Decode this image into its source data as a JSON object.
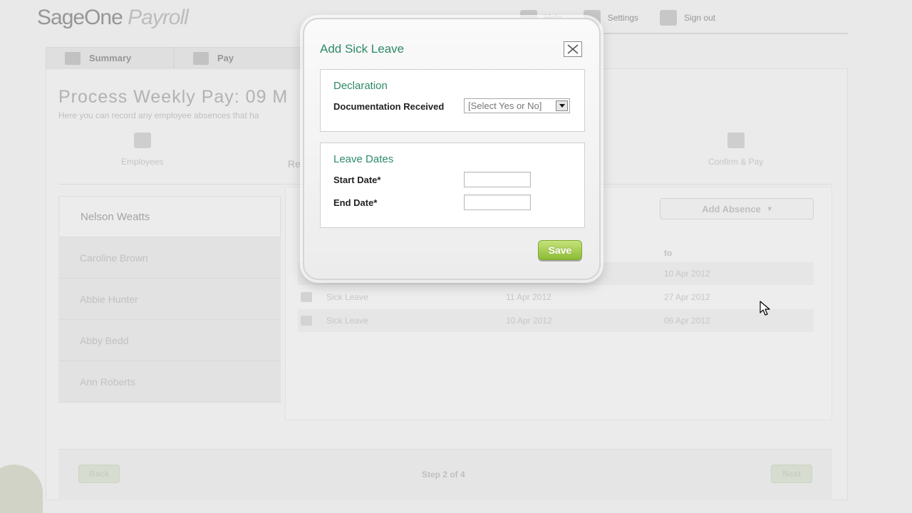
{
  "app": {
    "logo_main": "SageOne",
    "logo_product": "Payroll",
    "top_links": [
      "Help",
      "Settings",
      "Sign out"
    ]
  },
  "tabs": [
    {
      "label": "Summary",
      "icon": "summary-icon"
    },
    {
      "label": "Pay",
      "icon": "pay-icon"
    }
  ],
  "page": {
    "title": "Process Weekly Pay: 09 M",
    "subtitle": "Here you can record any employee absences that ha"
  },
  "steps": {
    "items": [
      "Employees",
      "Re",
      "Confirm & Pay"
    ],
    "counter": "Step 2 of 4",
    "back_label": "Back",
    "next_label": "Next"
  },
  "employees": [
    {
      "name": "Nelson Weatts",
      "active": true
    },
    {
      "name": "Caroline Brown",
      "active": false
    },
    {
      "name": "Abbie Hunter",
      "active": false
    },
    {
      "name": "Abby Bedd",
      "active": false
    },
    {
      "name": "Ann Roberts",
      "active": false
    }
  ],
  "absences": {
    "add_button_label": "Add Absence",
    "col_to": "to",
    "rows": [
      {
        "type": "",
        "from": "",
        "to": "10 Apr 2012"
      },
      {
        "type": "Sick Leave",
        "from": "11 Apr 2012",
        "to": "27 Apr 2012"
      },
      {
        "type": "Sick Leave",
        "from": "10 Apr 2012",
        "to": "06 Apr 2012"
      }
    ]
  },
  "modal": {
    "title": "Add Sick Leave",
    "declaration_heading": "Declaration",
    "documentation_label": "Documentation Received",
    "documentation_select_value": "[Select Yes or No]",
    "leave_dates_heading": "Leave Dates",
    "start_date_label": "Start Date*",
    "start_date_value": "",
    "end_date_label": "End Date*",
    "end_date_value": "",
    "save_label": "Save"
  },
  "colors": {
    "accent_green": "#2e8a66",
    "save_green": "#8dbb36"
  }
}
